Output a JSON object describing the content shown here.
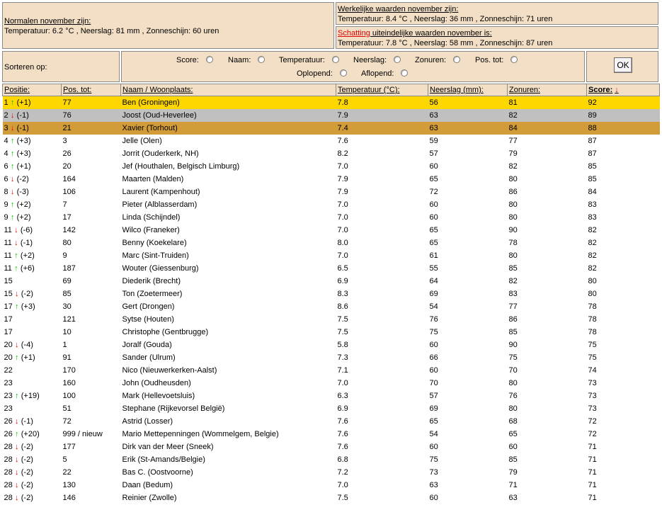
{
  "normals": {
    "title": "Normalen november zijn:",
    "text": "Temperatuur: 6.2 °C , Neerslag: 81 mm , Zonneschijn: 60 uren"
  },
  "actual": {
    "title": "Werkelijke waarden november zijn:",
    "text": "Temperatuur: 8.4 °C , Neerslag: 36 mm , Zonneschijn: 71 uren"
  },
  "estimate": {
    "title_red": "Schatting",
    "title_rest": " uiteindelijke waarden november is:",
    "text": "Temperatuur: 7.8 °C , Neerslag: 58 mm , Zonneschijn: 87 uren"
  },
  "sort": {
    "label": "Sorteren op:",
    "options": [
      "Score:",
      "Naam:",
      "Temperatuur:",
      "Neerslag:",
      "Zonuren:",
      "Pos. tot:"
    ],
    "order": [
      "Oplopend:",
      "Aflopend:"
    ],
    "ok": "OK"
  },
  "table": {
    "headers": [
      "Positie:",
      "Pos. tot:",
      "Naam / Woonplaats:",
      "Temperatuur (°C):",
      "Neerslag (mm):",
      "Zonuren:",
      "Score:"
    ],
    "sorted_column_arrow": "↓",
    "colors": {
      "gold": "#ffd700",
      "silver": "#c0c0c0",
      "bronze": "#d29c38",
      "up_arrow": "#00c000",
      "down_arrow": "#e00000"
    },
    "rows": [
      {
        "pos": "1",
        "dir": "up",
        "change": "(+1)",
        "tot": "77",
        "name": "Ben (Groningen)",
        "temp": "7.8",
        "rain": "56",
        "sun": "81",
        "score": "92"
      },
      {
        "pos": "2",
        "dir": "down",
        "change": "(-1)",
        "tot": "76",
        "name": "Joost (Oud-Heverlee)",
        "temp": "7.9",
        "rain": "63",
        "sun": "82",
        "score": "89"
      },
      {
        "pos": "3",
        "dir": "down",
        "change": "(-1)",
        "tot": "21",
        "name": "Xavier (Torhout)",
        "temp": "7.4",
        "rain": "63",
        "sun": "84",
        "score": "88"
      },
      {
        "pos": "4",
        "dir": "up",
        "change": "(+3)",
        "tot": "3",
        "name": "Jelle (Olen)",
        "temp": "7.6",
        "rain": "59",
        "sun": "77",
        "score": "87"
      },
      {
        "pos": "4",
        "dir": "up",
        "change": "(+3)",
        "tot": "26",
        "name": "Jorrit (Ouderkerk, NH)",
        "temp": "8.2",
        "rain": "57",
        "sun": "79",
        "score": "87"
      },
      {
        "pos": "6",
        "dir": "up",
        "change": "(+1)",
        "tot": "20",
        "name": "Jef (Houthalen, Belgisch Limburg)",
        "temp": "7.0",
        "rain": "60",
        "sun": "82",
        "score": "85"
      },
      {
        "pos": "6",
        "dir": "down",
        "change": "(-2)",
        "tot": "164",
        "name": "Maarten (Malden)",
        "temp": "7.9",
        "rain": "65",
        "sun": "80",
        "score": "85"
      },
      {
        "pos": "8",
        "dir": "down",
        "change": "(-3)",
        "tot": "106",
        "name": "Laurent (Kampenhout)",
        "temp": "7.9",
        "rain": "72",
        "sun": "86",
        "score": "84"
      },
      {
        "pos": "9",
        "dir": "up",
        "change": "(+2)",
        "tot": "7",
        "name": "Pieter (Alblasserdam)",
        "temp": "7.0",
        "rain": "60",
        "sun": "80",
        "score": "83"
      },
      {
        "pos": "9",
        "dir": "up",
        "change": "(+2)",
        "tot": "17",
        "name": "Linda (Schijndel)",
        "temp": "7.0",
        "rain": "60",
        "sun": "80",
        "score": "83"
      },
      {
        "pos": "11",
        "dir": "down",
        "change": "(-6)",
        "tot": "142",
        "name": "Wilco (Franeker)",
        "temp": "7.0",
        "rain": "65",
        "sun": "90",
        "score": "82"
      },
      {
        "pos": "11",
        "dir": "down",
        "change": "(-1)",
        "tot": "80",
        "name": "Benny (Koekelare)",
        "temp": "8.0",
        "rain": "65",
        "sun": "78",
        "score": "82"
      },
      {
        "pos": "11",
        "dir": "up",
        "change": "(+2)",
        "tot": "9",
        "name": "Marc (Sint-Truiden)",
        "temp": "7.0",
        "rain": "61",
        "sun": "80",
        "score": "82"
      },
      {
        "pos": "11",
        "dir": "up",
        "change": "(+6)",
        "tot": "187",
        "name": "Wouter (Giessenburg)",
        "temp": "6.5",
        "rain": "55",
        "sun": "85",
        "score": "82"
      },
      {
        "pos": "15",
        "dir": "",
        "change": "",
        "tot": "69",
        "name": "Diederik (Brecht)",
        "temp": "6.9",
        "rain": "64",
        "sun": "82",
        "score": "80"
      },
      {
        "pos": "15",
        "dir": "down",
        "change": "(-2)",
        "tot": "85",
        "name": "Ton (Zoetermeer)",
        "temp": "8.3",
        "rain": "69",
        "sun": "83",
        "score": "80"
      },
      {
        "pos": "17",
        "dir": "up",
        "change": "(+3)",
        "tot": "30",
        "name": "Gert (Drongen)",
        "temp": "8.6",
        "rain": "54",
        "sun": "77",
        "score": "78"
      },
      {
        "pos": "17",
        "dir": "",
        "change": "",
        "tot": "121",
        "name": "Sytse (Houten)",
        "temp": "7.5",
        "rain": "76",
        "sun": "86",
        "score": "78"
      },
      {
        "pos": "17",
        "dir": "",
        "change": "",
        "tot": "10",
        "name": "Christophe (Gentbrugge)",
        "temp": "7.5",
        "rain": "75",
        "sun": "85",
        "score": "78"
      },
      {
        "pos": "20",
        "dir": "down",
        "change": "(-4)",
        "tot": "1",
        "name": "Joralf (Gouda)",
        "temp": "5.8",
        "rain": "60",
        "sun": "90",
        "score": "75"
      },
      {
        "pos": "20",
        "dir": "up",
        "change": "(+1)",
        "tot": "91",
        "name": "Sander (Ulrum)",
        "temp": "7.3",
        "rain": "66",
        "sun": "75",
        "score": "75"
      },
      {
        "pos": "22",
        "dir": "",
        "change": "",
        "tot": "170",
        "name": "Nico (Nieuwerkerken-Aalst)",
        "temp": "7.1",
        "rain": "60",
        "sun": "70",
        "score": "74"
      },
      {
        "pos": "23",
        "dir": "",
        "change": "",
        "tot": "160",
        "name": "John (Oudheusden)",
        "temp": "7.0",
        "rain": "70",
        "sun": "80",
        "score": "73"
      },
      {
        "pos": "23",
        "dir": "up",
        "change": "(+19)",
        "tot": "100",
        "name": "Mark (Hellevoetsluis)",
        "temp": "6.3",
        "rain": "57",
        "sun": "76",
        "score": "73"
      },
      {
        "pos": "23",
        "dir": "",
        "change": "",
        "tot": "51",
        "name": "Stephane (Rijkevorsel België)",
        "temp": "6.9",
        "rain": "69",
        "sun": "80",
        "score": "73"
      },
      {
        "pos": "26",
        "dir": "down",
        "change": "(-1)",
        "tot": "72",
        "name": "Astrid (Losser)",
        "temp": "7.6",
        "rain": "65",
        "sun": "68",
        "score": "72"
      },
      {
        "pos": "26",
        "dir": "up",
        "change": "(+20)",
        "tot": "999 / nieuw",
        "name": "Mario Mettepenningen (Wommelgem, Belgie)",
        "temp": "7.6",
        "rain": "54",
        "sun": "65",
        "score": "72"
      },
      {
        "pos": "28",
        "dir": "down",
        "change": "(-2)",
        "tot": "177",
        "name": "Dirk van der Meer (Sneek)",
        "temp": "7.6",
        "rain": "60",
        "sun": "60",
        "score": "71"
      },
      {
        "pos": "28",
        "dir": "down",
        "change": "(-2)",
        "tot": "5",
        "name": "Erik (St-Amands/Belgie)",
        "temp": "6.8",
        "rain": "75",
        "sun": "85",
        "score": "71"
      },
      {
        "pos": "28",
        "dir": "down",
        "change": "(-2)",
        "tot": "22",
        "name": "Bas C. (Oostvoorne)",
        "temp": "7.2",
        "rain": "73",
        "sun": "79",
        "score": "71"
      },
      {
        "pos": "28",
        "dir": "down",
        "change": "(-2)",
        "tot": "130",
        "name": "Daan (Bedum)",
        "temp": "7.0",
        "rain": "63",
        "sun": "71",
        "score": "71"
      },
      {
        "pos": "28",
        "dir": "down",
        "change": "(-2)",
        "tot": "146",
        "name": "Reinier (Zwolle)",
        "temp": "7.5",
        "rain": "60",
        "sun": "63",
        "score": "71"
      }
    ]
  }
}
